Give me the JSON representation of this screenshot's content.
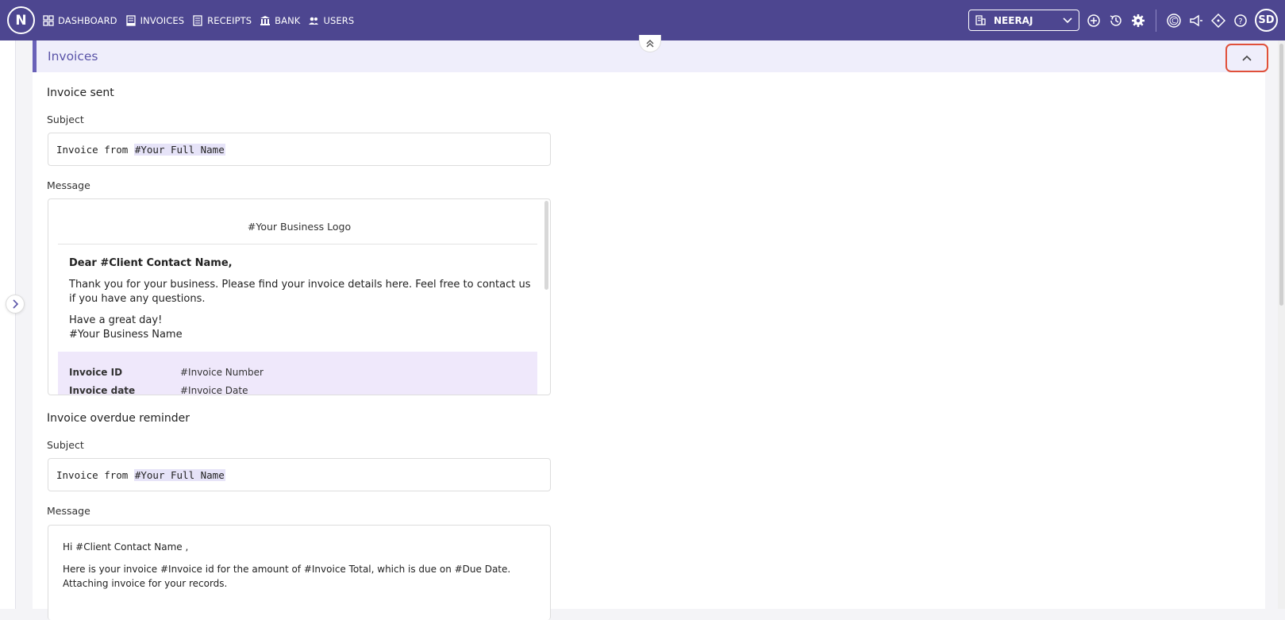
{
  "app": {
    "logo_letter": "N"
  },
  "nav": [
    {
      "label": "DASHBOARD",
      "icon": "grid-icon"
    },
    {
      "label": "INVOICES",
      "icon": "invoice-icon"
    },
    {
      "label": "RECEIPTS",
      "icon": "receipt-icon"
    },
    {
      "label": "BANK",
      "icon": "bank-icon"
    },
    {
      "label": "USERS",
      "icon": "users-icon"
    }
  ],
  "org_select": {
    "value": "NEERAJ"
  },
  "user": {
    "initials": "SD"
  },
  "section": {
    "title": "Invoices"
  },
  "invoice_sent": {
    "heading": "Invoice sent",
    "subject_label": "Subject",
    "subject_prefix": "Invoice from ",
    "subject_tag": "#Your Full Name",
    "message_label": "Message",
    "logo_placeholder": "#Your Business Logo",
    "greeting": "Dear #Client Contact Name,",
    "body_line1": "Thank you for your business. Please find your invoice details here. Feel free to contact us",
    "body_line2": "if you have any questions.",
    "closing1": "Have a great day!",
    "closing2": "#Your Business Name",
    "details": [
      {
        "key": "Invoice ID",
        "value": "#Invoice Number"
      },
      {
        "key": "Invoice date",
        "value": "#Invoice Date"
      }
    ]
  },
  "invoice_overdue": {
    "heading": "Invoice overdue reminder",
    "subject_label": "Subject",
    "subject_prefix": "Invoice from ",
    "subject_tag": "#Your Full Name",
    "message_label": "Message",
    "line1": "Hi #Client Contact Name ,",
    "line2": "Here is your invoice #Invoice id for the amount of #Invoice Total, which is due on #Due Date.",
    "line3": "Attaching invoice for your records."
  },
  "colors": {
    "topbar": "#4d4690",
    "accent": "#6961b8",
    "highlight_border": "#e0503a"
  }
}
